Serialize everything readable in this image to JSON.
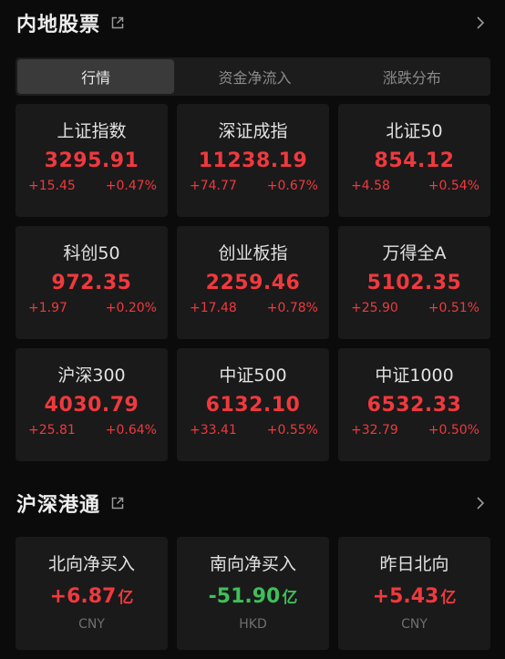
{
  "mainland": {
    "title": "内地股票",
    "tabs": [
      {
        "label": "行情",
        "active": true
      },
      {
        "label": "资金净流入",
        "active": false
      },
      {
        "label": "涨跌分布",
        "active": false
      }
    ],
    "indices": [
      {
        "name": "上证指数",
        "value": "3295.91",
        "change": "+15.45",
        "pct": "+0.47%"
      },
      {
        "name": "深证成指",
        "value": "11238.19",
        "change": "+74.77",
        "pct": "+0.67%"
      },
      {
        "name": "北证50",
        "value": "854.12",
        "change": "+4.58",
        "pct": "+0.54%"
      },
      {
        "name": "科创50",
        "value": "972.35",
        "change": "+1.97",
        "pct": "+0.20%"
      },
      {
        "name": "创业板指",
        "value": "2259.46",
        "change": "+17.48",
        "pct": "+0.78%"
      },
      {
        "name": "万得全A",
        "value": "5102.35",
        "change": "+25.90",
        "pct": "+0.51%"
      },
      {
        "name": "沪深300",
        "value": "4030.79",
        "change": "+25.81",
        "pct": "+0.64%"
      },
      {
        "name": "中证500",
        "value": "6132.10",
        "change": "+33.41",
        "pct": "+0.55%"
      },
      {
        "name": "中证1000",
        "value": "6532.33",
        "change": "+32.79",
        "pct": "+0.50%"
      }
    ]
  },
  "connect": {
    "title": "沪深港通",
    "flows": [
      {
        "name": "北向净买入",
        "value": "+6.87",
        "unit": "亿",
        "currency": "CNY",
        "direction": "up"
      },
      {
        "name": "南向净买入",
        "value": "-51.90",
        "unit": "亿",
        "currency": "HKD",
        "direction": "down"
      },
      {
        "name": "昨日北向",
        "value": "+5.43",
        "unit": "亿",
        "currency": "CNY",
        "direction": "up"
      }
    ]
  },
  "colors": {
    "up": "#f0393e",
    "down": "#3fbf5a",
    "background": "#0b0b0b",
    "card": "#1a1a1a"
  },
  "icons": {
    "external": "external-link-icon",
    "chevron": "chevron-right-icon"
  }
}
